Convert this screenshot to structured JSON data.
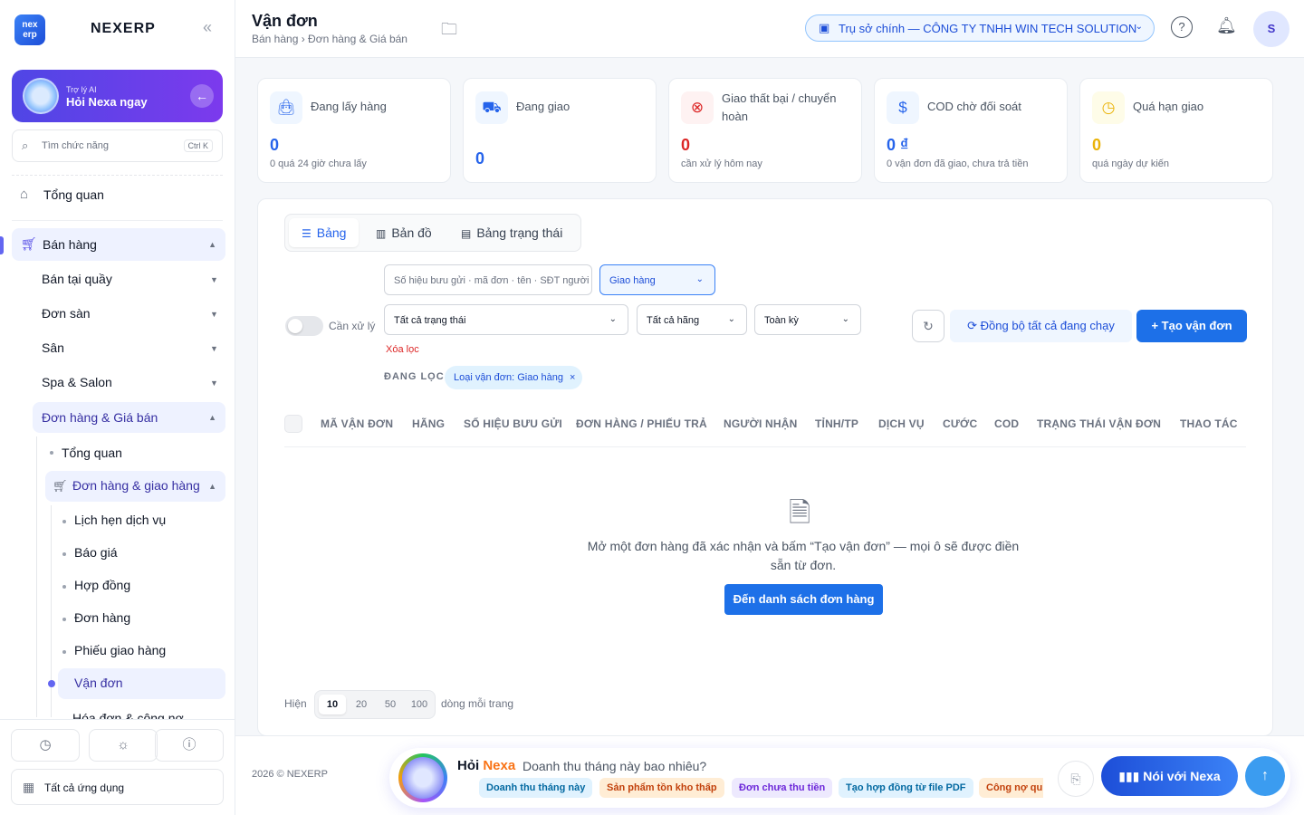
{
  "sidebar": {
    "logo_text": "nex erp",
    "brand": "NEXERP",
    "ai": {
      "sub": "Trợ lý AI",
      "title": "Hỏi Nexa ngay"
    },
    "search": {
      "placeholder": "Tìm chức năng",
      "shortcut": "Ctrl K"
    },
    "overview": "Tổng quan",
    "sales": "Bán hàng",
    "items": [
      "Bán tại quầy",
      "Đơn sàn",
      "Sân",
      "Spa & Salon",
      "Đơn hàng & Giá bán"
    ],
    "sub_overview": "Tổng quan",
    "orders_delivery": "Đơn hàng & giao hàng",
    "leaves": [
      "Lịch hẹn dịch vụ",
      "Báo giá",
      "Hợp đồng",
      "Đơn hàng",
      "Phiếu giao hàng",
      "Vận đơn"
    ],
    "next_group": "Hóa đơn & công nợ",
    "all_apps": "Tất cả ứng dụng"
  },
  "header": {
    "title": "Vận đơn",
    "breadcrumb": "Bán hàng › Đơn hàng & Giá bán",
    "branch": "Trụ sở chính — CÔNG TY TNHH WIN TECH SOLUTION",
    "user_initial": "S"
  },
  "kpis": [
    {
      "label": "Đang lấy hàng",
      "value": "0",
      "sub": "0 quá 24 giờ chưa lấy",
      "color": "#2563eb",
      "bg": "#eff6ff",
      "icon": "bag-icon"
    },
    {
      "label": "Đang giao",
      "value": "0",
      "sub": "",
      "color": "#2563eb",
      "bg": "#eff6ff",
      "icon": "truck-icon"
    },
    {
      "label": "Giao thất bại / chuyển hoàn",
      "value": "0",
      "sub": "cần xử lý hôm nay",
      "color": "#dc2626",
      "bg": "#fef2f2",
      "icon": "x-circle-icon"
    },
    {
      "label": "COD chờ đối soát",
      "value": "0 ₫",
      "sub": "0 vận đơn đã giao, chưa trả tiền",
      "color": "#2563eb",
      "bg": "#eff6ff",
      "icon": "dollar-icon"
    },
    {
      "label": "Quá hạn giao",
      "value": "0",
      "sub": "quá ngày dự kiến",
      "color": "#eab308",
      "bg": "#fefce8",
      "icon": "clock-icon"
    }
  ],
  "tabs": [
    "Bảng",
    "Bản đồ",
    "Bảng trạng thái"
  ],
  "filters": {
    "search_placeholder": "Số hiệu bưu gửi · mã đơn · tên · SĐT người",
    "type": "Giao hàng",
    "status": "Tất cả trạng thái",
    "carrier": "Tất cả hãng",
    "period": "Toàn kỳ",
    "toggle_label": "Cần xử lý",
    "clear": "Xóa lọc",
    "active_label": "ĐANG LỌC",
    "chip": "Loại vận đơn: Giao hàng"
  },
  "actions": {
    "sync": "Đồng bộ tất cả đang chạy",
    "create": "Tạo vận đơn"
  },
  "columns": [
    "MÃ VẬN ĐƠN",
    "HÃNG",
    "SỐ HIỆU BƯU GỬI",
    "ĐƠN HÀNG / PHIẾU TRẢ",
    "NGƯỜI NHẬN",
    "TỈNH/TP",
    "DỊCH VỤ",
    "CƯỚC",
    "COD",
    "TRẠNG THÁI VẬN ĐƠN",
    "THAO TÁC"
  ],
  "empty": {
    "text": "Mở một đơn hàng đã xác nhận và bấm “Tạo vận đơn” — mọi ô sẽ được điền sẵn từ đơn.",
    "button": "Đến danh sách đơn hàng"
  },
  "pagination": {
    "show": "Hiện",
    "sizes": [
      "10",
      "20",
      "50",
      "100"
    ],
    "selected": "10",
    "suffix": "dòng mỗi trang"
  },
  "footer": {
    "copyright": "2026 © NEXERP"
  },
  "nexa_bar": {
    "hoi": "Hỏi",
    "nexa": "Nexa",
    "question": "Doanh thu tháng này bao nhiêu?",
    "suggestions": [
      {
        "text": "Doanh thu tháng này",
        "bg": "#e0f2fe",
        "color": "#0369a1"
      },
      {
        "text": "Sản phẩm tồn kho thấp",
        "bg": "#ffedd5",
        "color": "#c2410c"
      },
      {
        "text": "Đơn chưa thu tiền",
        "bg": "#ede9fe",
        "color": "#6d28d9"
      },
      {
        "text": "Tạo hợp đồng từ file PDF",
        "bg": "#e0f2fe",
        "color": "#0369a1"
      },
      {
        "text": "Công nợ qu",
        "bg": "#ffedd5",
        "color": "#c2410c"
      }
    ],
    "talk": "Nói với Nexa"
  }
}
